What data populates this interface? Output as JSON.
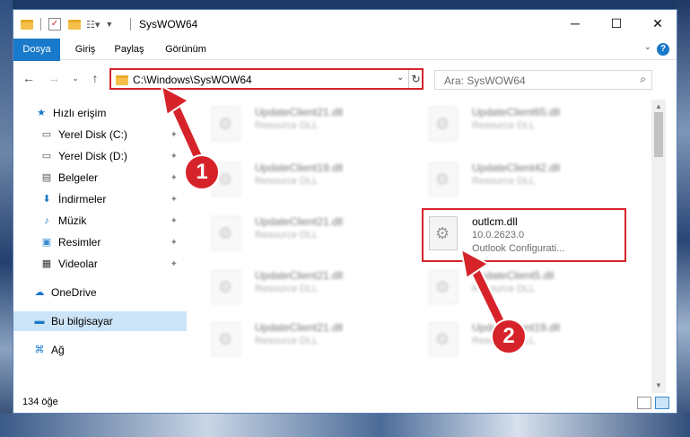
{
  "window": {
    "title": "SysWOW64"
  },
  "title_controls": {
    "minimize": "─",
    "maximize": "☐",
    "close": "✕"
  },
  "ribbon": {
    "tabs": [
      {
        "label": "Dosya"
      },
      {
        "label": "Giriş"
      },
      {
        "label": "Paylaş"
      },
      {
        "label": "Görünüm"
      }
    ],
    "help": "?"
  },
  "address": {
    "path": "C:\\Windows\\SysWOW64"
  },
  "search": {
    "placeholder": "Ara: SysWOW64"
  },
  "sidebar": {
    "items": [
      {
        "label": "Hızlı erişim",
        "icon": "star-icon"
      },
      {
        "label": "Yerel Disk (C:)",
        "icon": "drive-icon"
      },
      {
        "label": "Yerel Disk (D:)",
        "icon": "drive-icon"
      },
      {
        "label": "Belgeler",
        "icon": "document-icon"
      },
      {
        "label": "İndirmeler",
        "icon": "download-icon"
      },
      {
        "label": "Müzik",
        "icon": "music-icon"
      },
      {
        "label": "Resimler",
        "icon": "pictures-icon"
      },
      {
        "label": "Videolar",
        "icon": "video-icon"
      },
      {
        "label": "OneDrive",
        "icon": "cloud-icon"
      },
      {
        "label": "Bu bilgisayar",
        "icon": "computer-icon"
      },
      {
        "label": "Ağ",
        "icon": "network-icon"
      }
    ]
  },
  "files": [
    {
      "name": "UpdateClient21.dll",
      "desc": "Resource DLL"
    },
    {
      "name": "UpdateClient65.dll",
      "desc": "Resource DLL"
    },
    {
      "name": "UpdateClient19.dll",
      "desc": "Resource DLL"
    },
    {
      "name": "UpdateClient42.dll",
      "desc": "Resource DLL"
    },
    {
      "name": "UpdateClient21.dll",
      "desc": "Resource DLL"
    },
    {
      "name": "outlcm.dll",
      "desc": "10.0.2623.0",
      "desc2": "Outlook Configurati..."
    },
    {
      "name": "UpdateClient21.dll",
      "desc": "Resource DLL"
    },
    {
      "name": "UpdateClient5.dll",
      "desc": "Resource DLL"
    },
    {
      "name": "UpdateClient21.dll",
      "desc": "Resource DLL"
    },
    {
      "name": "UpdateClient19.dll",
      "desc": "Resource DLL"
    }
  ],
  "status": {
    "count": "134 öğe"
  },
  "annotations": {
    "step1": "1",
    "step2": "2",
    "color": "#d6232a"
  }
}
